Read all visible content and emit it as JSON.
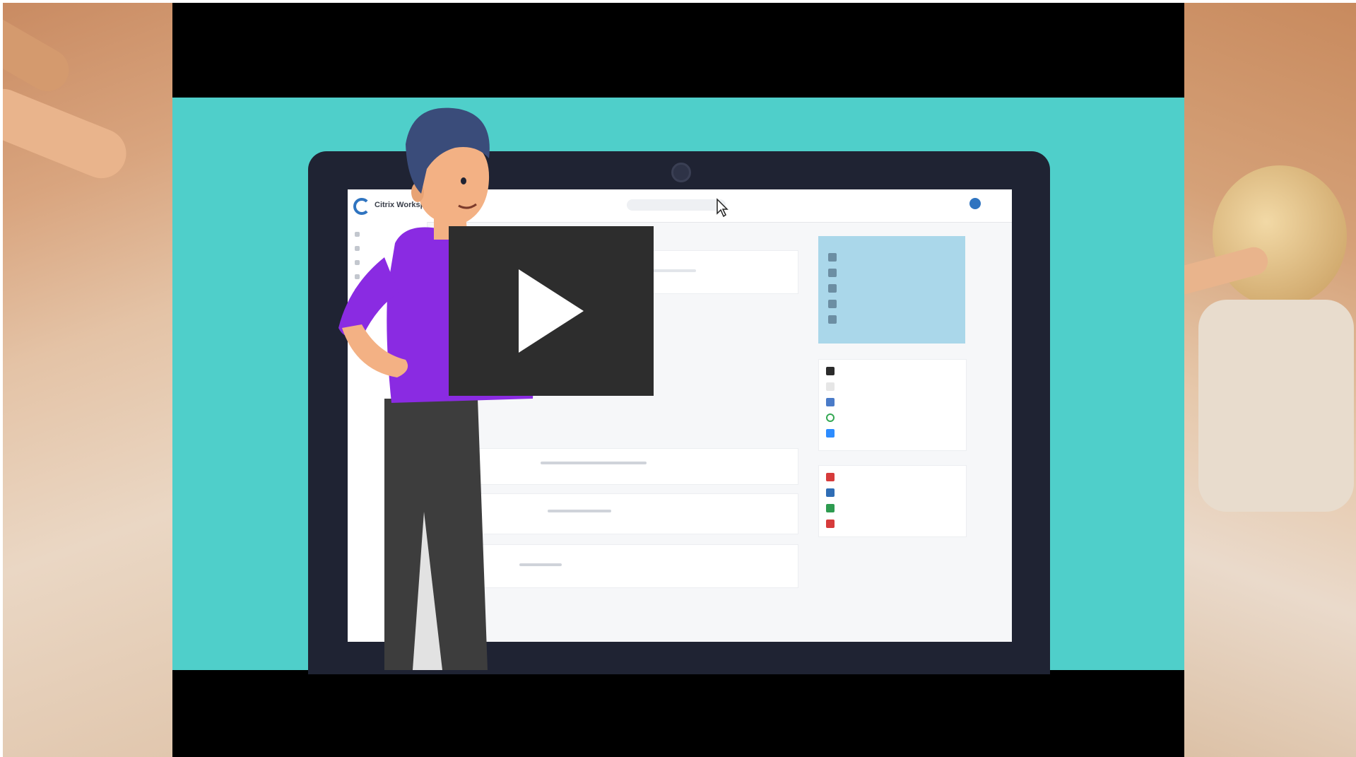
{
  "video": {
    "play_button_label": "",
    "thumbnail_alt": ""
  },
  "screen": {
    "app_name": "Citrix Workspace",
    "search_placeholder": "",
    "nav_items": [
      "",
      "",
      "",
      "",
      ""
    ],
    "right_panel": {
      "title": "",
      "rows": [
        "",
        "",
        "",
        "",
        ""
      ],
      "more_link": ""
    },
    "apps_section_title": "",
    "apps": [
      "",
      "",
      "",
      "",
      ""
    ],
    "recent_files_title": "",
    "recent_files": [
      "",
      "",
      "",
      ""
    ],
    "recommended_title": ""
  },
  "colors": {
    "stage_bg": "#4fcfca",
    "laptop_body": "#1f2333",
    "accent": "#2f74c0",
    "highlight_panel": "#aad7ea",
    "character_shirt": "#8a2be2",
    "character_pants": "#3d3d3d",
    "character_hair": "#3a4c7a",
    "play_button_bg": "#2d2d2d"
  },
  "icons": {
    "play": "play-icon",
    "cursor": "mouse-pointer-icon"
  }
}
